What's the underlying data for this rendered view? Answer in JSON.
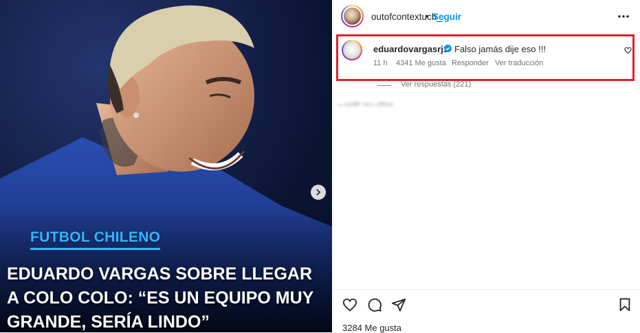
{
  "post": {
    "tag": "FUTBOL CHILENO",
    "headline": "EDUARDO VARGAS SOBRE LLEGAR A COLO COLO: “ES UN EQUIPO MUY GRANDE, SERÍA LINDO”",
    "next_icon": "chevron-right-icon"
  },
  "header": {
    "username": "outofcontextuch_",
    "separator": "•",
    "follow_label": "Seguir",
    "more_icon": "more-horizontal-icon"
  },
  "comment": {
    "username": "eduardovargasrj1",
    "verified": true,
    "text": "Falso jamás dije eso !!!",
    "time": "11 h",
    "likes": "4341 Me gusta",
    "reply_label": "Responder",
    "translate_label": "Ver traducción",
    "view_replies": "Ver respuestas (221)",
    "highlight_color": "#e0202a"
  },
  "actions": {
    "like_icon": "heart-icon",
    "comment_icon": "comment-icon",
    "share_icon": "share-icon",
    "save_icon": "bookmark-icon"
  },
  "footer": {
    "likes": "3284 Me gusta"
  },
  "colors": {
    "link_blue": "#0095f6",
    "tag_blue": "#2fb7ff",
    "text_primary": "#262626",
    "text_secondary": "#737373"
  }
}
